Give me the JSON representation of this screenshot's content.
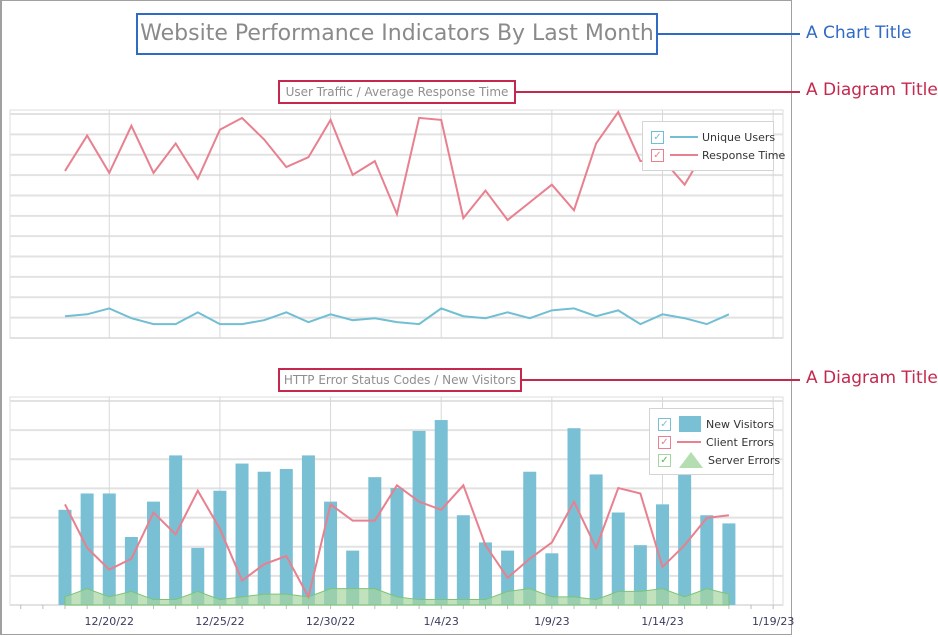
{
  "annotations": {
    "chart_title_label": "A Chart Title",
    "diagram_title_label_1": "A Diagram Title",
    "diagram_title_label_2": "A Diagram Title"
  },
  "colors": {
    "chart_title_accent": "#2f6bc4",
    "diagram_title_accent": "#c4284d",
    "unique_users": "#72bfd4",
    "response_time": "#e8808f",
    "new_visitors": "#79c0d4",
    "client_errors": "#e8808f",
    "server_errors": "#a6d6a0"
  },
  "chart_data": [
    {
      "type": "line",
      "chart_title": "Website Performance Indicators By Last Month",
      "title": "User Traffic / Average Response Time",
      "xlabel": "",
      "ylabel": "",
      "x_start": "12/18/22",
      "x_ticks": [
        "12/20/22",
        "12/25/22",
        "12/30/22",
        "1/4/23",
        "1/9/23",
        "1/14/23",
        "1/19/23"
      ],
      "grid": true,
      "legend_position": "top-right",
      "ylim": [
        0,
        11
      ],
      "series": [
        {
          "name": "Unique Users",
          "checked": true,
          "values": [
            0.7,
            0.8,
            1.1,
            0.6,
            0.3,
            0.3,
            0.9,
            0.3,
            0.3,
            0.5,
            0.9,
            0.4,
            0.8,
            0.5,
            0.6,
            0.4,
            0.3,
            1.1,
            0.7,
            0.6,
            0.9,
            0.6,
            1.0,
            1.1,
            0.7,
            1.0,
            0.3,
            0.8,
            0.6,
            0.3,
            0.8
          ]
        },
        {
          "name": "Response Time",
          "checked": true,
          "values": [
            8.1,
            9.9,
            8.0,
            10.4,
            8.0,
            9.5,
            7.7,
            10.2,
            10.8,
            9.7,
            8.3,
            8.8,
            10.7,
            7.9,
            8.6,
            5.9,
            10.8,
            10.7,
            5.7,
            7.1,
            5.6,
            6.5,
            7.4,
            6.1,
            9.5,
            11.1,
            8.6,
            8.7,
            7.4,
            9.3
          ]
        }
      ]
    },
    {
      "type": "bar",
      "title": "HTTP Error Status Codes / New Visitors",
      "xlabel": "",
      "ylabel": "",
      "x_start": "12/18/22",
      "x_ticks": [
        "12/20/22",
        "12/25/22",
        "12/30/22",
        "1/4/23",
        "1/9/23",
        "1/14/23",
        "1/19/23"
      ],
      "grid": true,
      "legend_position": "top-right",
      "ylim": [
        0,
        7.5
      ],
      "series": [
        {
          "name": "New Visitors",
          "type": "bar",
          "checked": true,
          "values": [
            3.5,
            4.1,
            4.1,
            2.5,
            3.8,
            5.5,
            2.1,
            4.2,
            5.2,
            4.9,
            5.0,
            5.5,
            3.8,
            2.0,
            4.7,
            4.3,
            6.4,
            6.8,
            3.3,
            2.3,
            2.0,
            4.9,
            1.9,
            6.5,
            4.8,
            3.4,
            2.2,
            3.7,
            5.0,
            3.3,
            3.0
          ]
        },
        {
          "name": "Client Errors",
          "type": "line",
          "checked": true,
          "values": [
            3.7,
            2.1,
            1.3,
            1.7,
            3.4,
            2.6,
            4.2,
            2.8,
            0.9,
            1.5,
            1.8,
            0.3,
            3.7,
            3.1,
            3.1,
            4.4,
            3.8,
            3.5,
            4.4,
            2.2,
            1.0,
            1.7,
            2.3,
            3.8,
            2.1,
            4.3,
            4.1,
            1.4,
            2.2,
            3.2,
            3.3
          ]
        },
        {
          "name": "Server Errors",
          "type": "area",
          "checked": true,
          "values": [
            0.3,
            0.6,
            0.3,
            0.5,
            0.2,
            0.2,
            0.5,
            0.2,
            0.3,
            0.4,
            0.4,
            0.3,
            0.6,
            0.6,
            0.6,
            0.3,
            0.2,
            0.2,
            0.2,
            0.2,
            0.5,
            0.6,
            0.3,
            0.3,
            0.2,
            0.5,
            0.5,
            0.6,
            0.3,
            0.6,
            0.4
          ]
        }
      ]
    }
  ]
}
